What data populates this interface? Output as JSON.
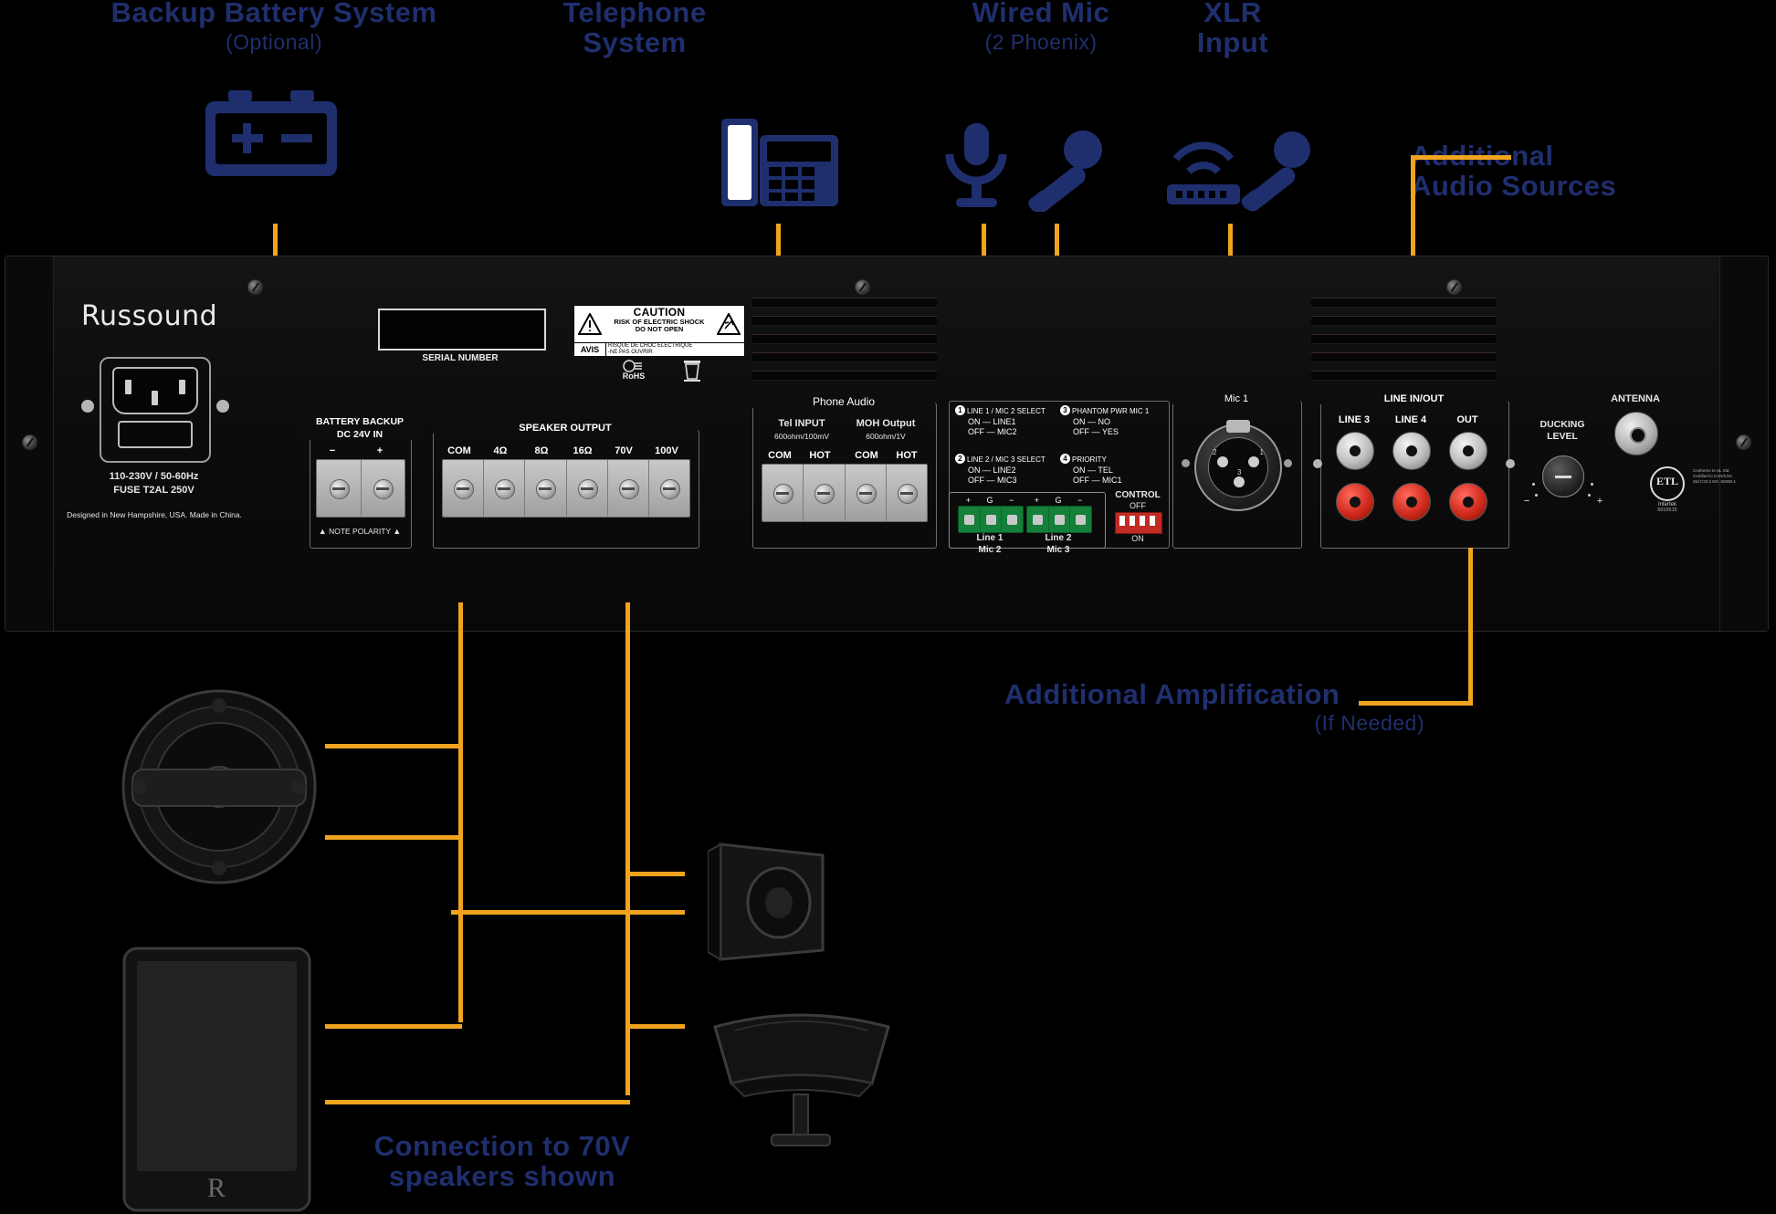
{
  "callouts": {
    "battery": {
      "title": "Backup Battery System",
      "sub": "(Optional)"
    },
    "telephone": {
      "title": "Telephone",
      "title2": "System"
    },
    "wired_mic": {
      "title": "Wired Mic",
      "sub": "(2 Phoenix)"
    },
    "xlr": {
      "title": "XLR",
      "title2": "Input"
    },
    "audio_sources": {
      "title": "Additional",
      "title2": "Audio Sources"
    },
    "amplification": {
      "title": "Additional Amplification",
      "sub": "(If Needed)"
    },
    "speakers": {
      "title": "Connection to 70V",
      "title2": "speakers shown"
    }
  },
  "panel": {
    "brand": "Russound",
    "power": {
      "voltage": "110-230V / 50-60Hz",
      "fuse": "FUSE T2AL 250V",
      "origin": "Designed in New Hampshire, USA. Made in China."
    },
    "serial_label": "SERIAL NUMBER",
    "caution": {
      "avis": "AVIS",
      "title": "CAUTION",
      "line1": "RISK OF ELECTRIC SHOCK",
      "line2": "DO NOT OPEN",
      "fr1": "RISQUE DE CHOC ELECTRIQUE",
      "fr2": "-NE PAS OUVRIR",
      "rohs": "RoHS"
    },
    "battery_backup": {
      "title": "BATTERY BACKUP",
      "subtitle": "DC 24V IN",
      "terminals": [
        "−",
        "+"
      ],
      "note": "NOTE POLARITY"
    },
    "speaker_output": {
      "title": "SPEAKER OUTPUT",
      "terminals": [
        "COM",
        "4Ω",
        "8Ω",
        "16Ω",
        "70V",
        "100V"
      ]
    },
    "phone_audio": {
      "title": "Phone Audio",
      "tel_input": {
        "label": "Tel INPUT",
        "spec": "600ohm/100mV",
        "terminals": [
          "COM",
          "HOT"
        ]
      },
      "moh_output": {
        "label": "MOH Output",
        "spec": "600ohm/1V",
        "terminals": [
          "COM",
          "HOT"
        ]
      }
    },
    "mic_selects": [
      {
        "num": "1",
        "title": "LINE 1 / MIC 2 SELECT",
        "rows": [
          "ON  — LINE1",
          "OFF — MIC2"
        ]
      },
      {
        "num": "2",
        "title": "LINE 2 / MIC 3 SELECT",
        "rows": [
          "ON  — LINE2",
          "OFF — MIC3"
        ]
      },
      {
        "num": "3",
        "title": "PHANTOM PWR MIC 1",
        "rows": [
          "ON  — NO",
          "OFF — YES"
        ]
      },
      {
        "num": "4",
        "title": "PRIORITY",
        "rows": [
          "ON  — TEL",
          "OFF — MIC1"
        ]
      }
    ],
    "phoenix": [
      {
        "pins": [
          "+",
          "G",
          "−"
        ],
        "label1": "Line 1",
        "label2": "Mic 2"
      },
      {
        "pins": [
          "+",
          "G",
          "−"
        ],
        "label1": "Line 2",
        "label2": "Mic 3"
      }
    ],
    "control": {
      "title": "CONTROL",
      "off": "OFF",
      "on": "ON"
    },
    "mic1": {
      "label": "Mic 1",
      "pins": [
        "2",
        "1",
        "3"
      ]
    },
    "line_inout": {
      "title": "LINE IN/OUT",
      "columns": [
        "LINE 3",
        "LINE 4",
        "OUT"
      ]
    },
    "ducking": {
      "line1": "DUCKING",
      "line2": "LEVEL",
      "minus": "−",
      "plus": "+"
    },
    "antenna": {
      "label": "ANTENNA"
    },
    "etl": {
      "mark": "ETL",
      "line1": "Conforms to UL Std",
      "line2": "Certified to CAN/CSA",
      "line3": "Std C22.2 NO. 60065-1",
      "brand": "Intertek",
      "number": "5015515"
    }
  }
}
